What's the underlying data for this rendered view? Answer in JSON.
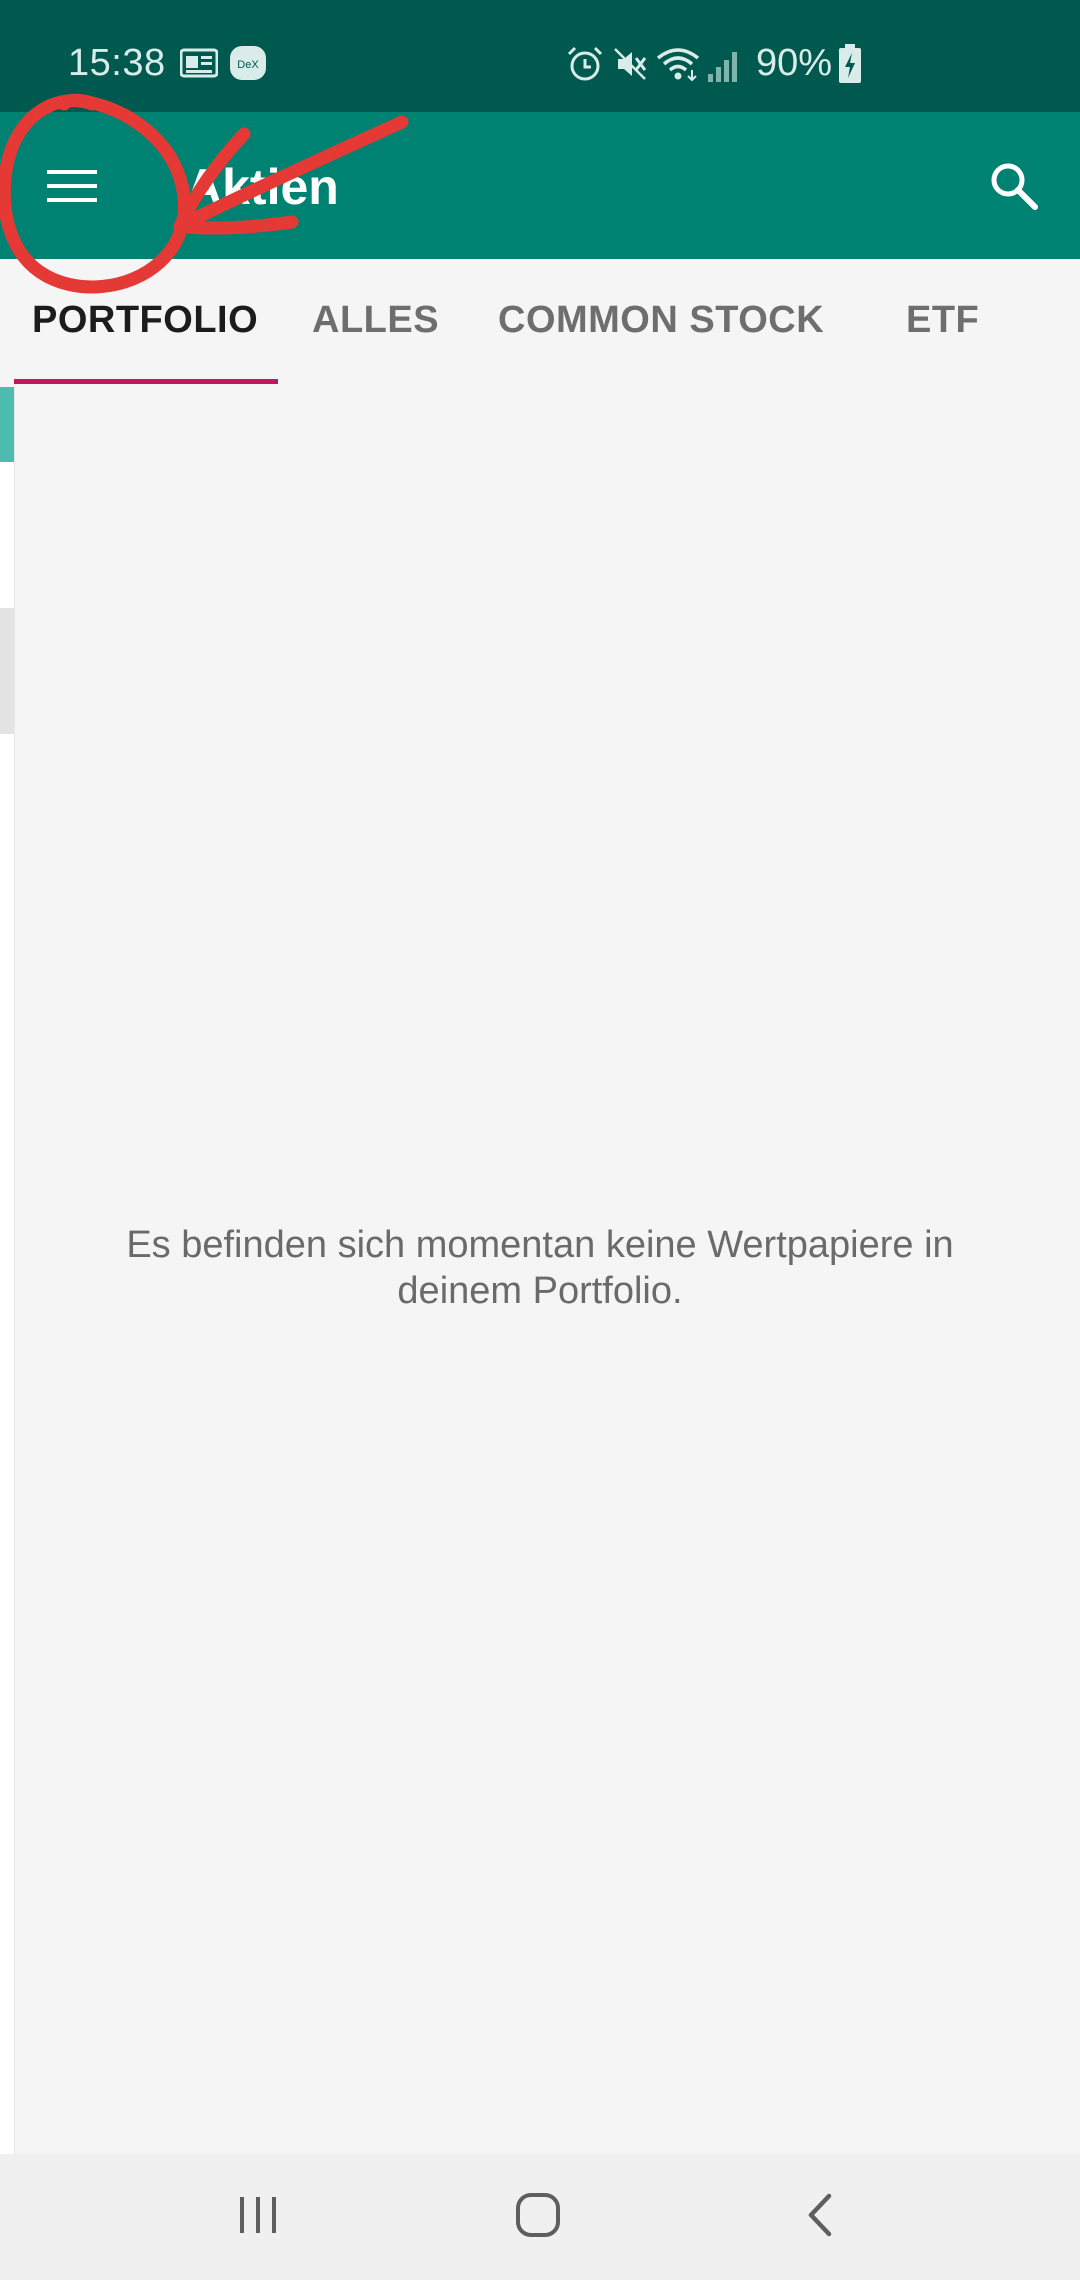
{
  "status_bar": {
    "time": "15:38",
    "battery_percent": "90%",
    "icons": [
      "news-icon",
      "dex-icon",
      "alarm-icon",
      "mute-icon",
      "wifi-icon",
      "signal-icon",
      "battery-charging-icon"
    ],
    "dex_label": "DeX"
  },
  "app_bar": {
    "title": "Aktien",
    "menu_icon": "hamburger-menu-icon",
    "search_icon": "search-icon"
  },
  "tabs": [
    {
      "label": "PORTFOLIO",
      "active": true
    },
    {
      "label": "ALLES",
      "active": false
    },
    {
      "label": "COMMON STOCK",
      "active": false
    },
    {
      "label": "ETF",
      "active": false
    }
  ],
  "main": {
    "empty_message": "Es befinden sich momentan keine Wertpapiere in deinem Portfolio."
  },
  "nav_bar": {
    "icons": [
      "recent-apps-icon",
      "home-icon",
      "back-icon"
    ]
  },
  "colors": {
    "status_bar": "#00594e",
    "app_bar": "#008272",
    "tab_indicator": "#c2185b",
    "annotation": "#e53935"
  }
}
